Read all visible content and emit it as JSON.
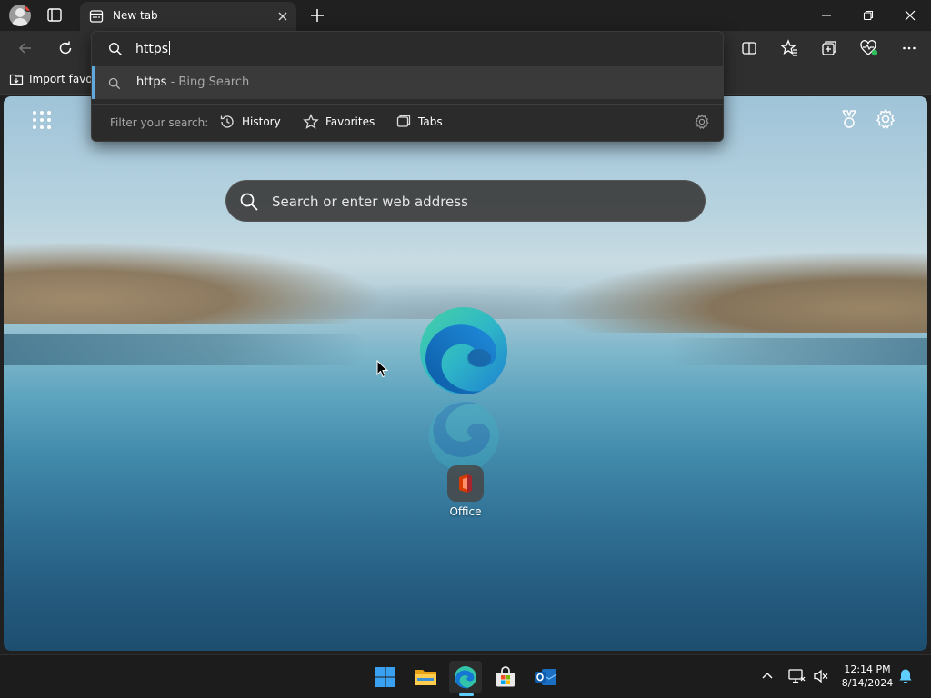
{
  "browser": {
    "tab": {
      "title": "New tab"
    },
    "favorites_bar": {
      "import_label": "Import favor"
    }
  },
  "address_dropdown": {
    "input_value": "https",
    "suggestion": {
      "query": "https",
      "suffix": " - Bing Search"
    },
    "filter": {
      "label": "Filter your search:",
      "chips": [
        "History",
        "Favorites",
        "Tabs"
      ]
    }
  },
  "new_tab_page": {
    "search_placeholder": "Search or enter web address",
    "quick_links": [
      {
        "label": "Office"
      }
    ]
  },
  "taskbar": {
    "apps": [
      "start-icon",
      "file-explorer-icon",
      "edge-icon",
      "store-icon",
      "outlook-icon"
    ],
    "active_app": "edge-icon",
    "clock": {
      "time": "12:14 PM",
      "date": "8/14/2024"
    }
  },
  "colors": {
    "accent": "#60cdff",
    "suggestion_highlight": "#60a9dc",
    "titlebar": "#202020",
    "toolbar": "#2f2f2f"
  }
}
